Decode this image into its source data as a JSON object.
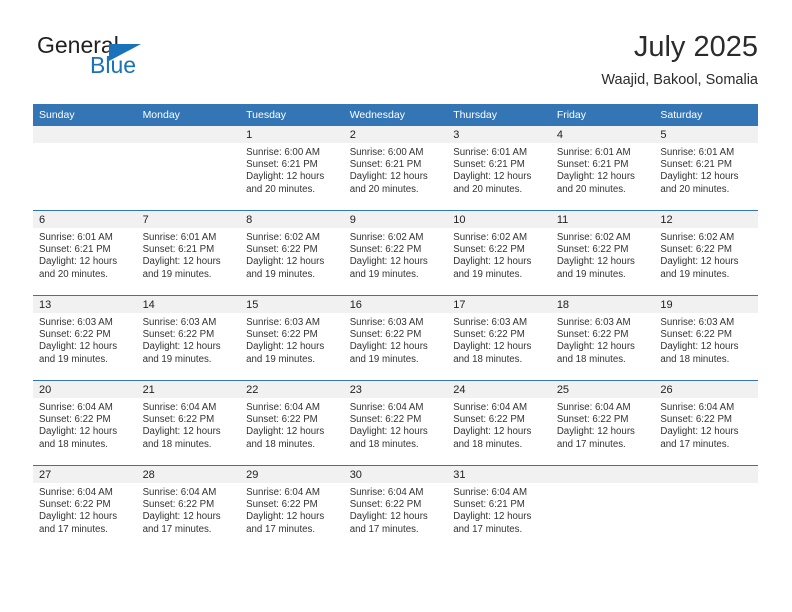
{
  "brand": {
    "name_part1": "General",
    "name_part2": "Blue",
    "triangle_color": "#1a72bb",
    "text_color": "#221f1f"
  },
  "header": {
    "title": "July 2025",
    "subtitle": "Waajid, Bakool, Somalia"
  },
  "theme": {
    "header_bg": "#3476b5",
    "daynum_bg": "#f1f1f1",
    "row_divider": "#3476b5"
  },
  "weekday_headers": [
    "Sunday",
    "Monday",
    "Tuesday",
    "Wednesday",
    "Thursday",
    "Friday",
    "Saturday"
  ],
  "weeks": [
    [
      {
        "day": "",
        "sunrise": "",
        "sunset": "",
        "daylight_line1": "",
        "daylight_line2": ""
      },
      {
        "day": "",
        "sunrise": "",
        "sunset": "",
        "daylight_line1": "",
        "daylight_line2": ""
      },
      {
        "day": "1",
        "sunrise": "Sunrise: 6:00 AM",
        "sunset": "Sunset: 6:21 PM",
        "daylight_line1": "Daylight: 12 hours",
        "daylight_line2": "and 20 minutes."
      },
      {
        "day": "2",
        "sunrise": "Sunrise: 6:00 AM",
        "sunset": "Sunset: 6:21 PM",
        "daylight_line1": "Daylight: 12 hours",
        "daylight_line2": "and 20 minutes."
      },
      {
        "day": "3",
        "sunrise": "Sunrise: 6:01 AM",
        "sunset": "Sunset: 6:21 PM",
        "daylight_line1": "Daylight: 12 hours",
        "daylight_line2": "and 20 minutes."
      },
      {
        "day": "4",
        "sunrise": "Sunrise: 6:01 AM",
        "sunset": "Sunset: 6:21 PM",
        "daylight_line1": "Daylight: 12 hours",
        "daylight_line2": "and 20 minutes."
      },
      {
        "day": "5",
        "sunrise": "Sunrise: 6:01 AM",
        "sunset": "Sunset: 6:21 PM",
        "daylight_line1": "Daylight: 12 hours",
        "daylight_line2": "and 20 minutes."
      }
    ],
    [
      {
        "day": "6",
        "sunrise": "Sunrise: 6:01 AM",
        "sunset": "Sunset: 6:21 PM",
        "daylight_line1": "Daylight: 12 hours",
        "daylight_line2": "and 20 minutes."
      },
      {
        "day": "7",
        "sunrise": "Sunrise: 6:01 AM",
        "sunset": "Sunset: 6:21 PM",
        "daylight_line1": "Daylight: 12 hours",
        "daylight_line2": "and 19 minutes."
      },
      {
        "day": "8",
        "sunrise": "Sunrise: 6:02 AM",
        "sunset": "Sunset: 6:22 PM",
        "daylight_line1": "Daylight: 12 hours",
        "daylight_line2": "and 19 minutes."
      },
      {
        "day": "9",
        "sunrise": "Sunrise: 6:02 AM",
        "sunset": "Sunset: 6:22 PM",
        "daylight_line1": "Daylight: 12 hours",
        "daylight_line2": "and 19 minutes."
      },
      {
        "day": "10",
        "sunrise": "Sunrise: 6:02 AM",
        "sunset": "Sunset: 6:22 PM",
        "daylight_line1": "Daylight: 12 hours",
        "daylight_line2": "and 19 minutes."
      },
      {
        "day": "11",
        "sunrise": "Sunrise: 6:02 AM",
        "sunset": "Sunset: 6:22 PM",
        "daylight_line1": "Daylight: 12 hours",
        "daylight_line2": "and 19 minutes."
      },
      {
        "day": "12",
        "sunrise": "Sunrise: 6:02 AM",
        "sunset": "Sunset: 6:22 PM",
        "daylight_line1": "Daylight: 12 hours",
        "daylight_line2": "and 19 minutes."
      }
    ],
    [
      {
        "day": "13",
        "sunrise": "Sunrise: 6:03 AM",
        "sunset": "Sunset: 6:22 PM",
        "daylight_line1": "Daylight: 12 hours",
        "daylight_line2": "and 19 minutes."
      },
      {
        "day": "14",
        "sunrise": "Sunrise: 6:03 AM",
        "sunset": "Sunset: 6:22 PM",
        "daylight_line1": "Daylight: 12 hours",
        "daylight_line2": "and 19 minutes."
      },
      {
        "day": "15",
        "sunrise": "Sunrise: 6:03 AM",
        "sunset": "Sunset: 6:22 PM",
        "daylight_line1": "Daylight: 12 hours",
        "daylight_line2": "and 19 minutes."
      },
      {
        "day": "16",
        "sunrise": "Sunrise: 6:03 AM",
        "sunset": "Sunset: 6:22 PM",
        "daylight_line1": "Daylight: 12 hours",
        "daylight_line2": "and 19 minutes."
      },
      {
        "day": "17",
        "sunrise": "Sunrise: 6:03 AM",
        "sunset": "Sunset: 6:22 PM",
        "daylight_line1": "Daylight: 12 hours",
        "daylight_line2": "and 18 minutes."
      },
      {
        "day": "18",
        "sunrise": "Sunrise: 6:03 AM",
        "sunset": "Sunset: 6:22 PM",
        "daylight_line1": "Daylight: 12 hours",
        "daylight_line2": "and 18 minutes."
      },
      {
        "day": "19",
        "sunrise": "Sunrise: 6:03 AM",
        "sunset": "Sunset: 6:22 PM",
        "daylight_line1": "Daylight: 12 hours",
        "daylight_line2": "and 18 minutes."
      }
    ],
    [
      {
        "day": "20",
        "sunrise": "Sunrise: 6:04 AM",
        "sunset": "Sunset: 6:22 PM",
        "daylight_line1": "Daylight: 12 hours",
        "daylight_line2": "and 18 minutes."
      },
      {
        "day": "21",
        "sunrise": "Sunrise: 6:04 AM",
        "sunset": "Sunset: 6:22 PM",
        "daylight_line1": "Daylight: 12 hours",
        "daylight_line2": "and 18 minutes."
      },
      {
        "day": "22",
        "sunrise": "Sunrise: 6:04 AM",
        "sunset": "Sunset: 6:22 PM",
        "daylight_line1": "Daylight: 12 hours",
        "daylight_line2": "and 18 minutes."
      },
      {
        "day": "23",
        "sunrise": "Sunrise: 6:04 AM",
        "sunset": "Sunset: 6:22 PM",
        "daylight_line1": "Daylight: 12 hours",
        "daylight_line2": "and 18 minutes."
      },
      {
        "day": "24",
        "sunrise": "Sunrise: 6:04 AM",
        "sunset": "Sunset: 6:22 PM",
        "daylight_line1": "Daylight: 12 hours",
        "daylight_line2": "and 18 minutes."
      },
      {
        "day": "25",
        "sunrise": "Sunrise: 6:04 AM",
        "sunset": "Sunset: 6:22 PM",
        "daylight_line1": "Daylight: 12 hours",
        "daylight_line2": "and 17 minutes."
      },
      {
        "day": "26",
        "sunrise": "Sunrise: 6:04 AM",
        "sunset": "Sunset: 6:22 PM",
        "daylight_line1": "Daylight: 12 hours",
        "daylight_line2": "and 17 minutes."
      }
    ],
    [
      {
        "day": "27",
        "sunrise": "Sunrise: 6:04 AM",
        "sunset": "Sunset: 6:22 PM",
        "daylight_line1": "Daylight: 12 hours",
        "daylight_line2": "and 17 minutes."
      },
      {
        "day": "28",
        "sunrise": "Sunrise: 6:04 AM",
        "sunset": "Sunset: 6:22 PM",
        "daylight_line1": "Daylight: 12 hours",
        "daylight_line2": "and 17 minutes."
      },
      {
        "day": "29",
        "sunrise": "Sunrise: 6:04 AM",
        "sunset": "Sunset: 6:22 PM",
        "daylight_line1": "Daylight: 12 hours",
        "daylight_line2": "and 17 minutes."
      },
      {
        "day": "30",
        "sunrise": "Sunrise: 6:04 AM",
        "sunset": "Sunset: 6:22 PM",
        "daylight_line1": "Daylight: 12 hours",
        "daylight_line2": "and 17 minutes."
      },
      {
        "day": "31",
        "sunrise": "Sunrise: 6:04 AM",
        "sunset": "Sunset: 6:21 PM",
        "daylight_line1": "Daylight: 12 hours",
        "daylight_line2": "and 17 minutes."
      },
      {
        "day": "",
        "sunrise": "",
        "sunset": "",
        "daylight_line1": "",
        "daylight_line2": ""
      },
      {
        "day": "",
        "sunrise": "",
        "sunset": "",
        "daylight_line1": "",
        "daylight_line2": ""
      }
    ]
  ]
}
